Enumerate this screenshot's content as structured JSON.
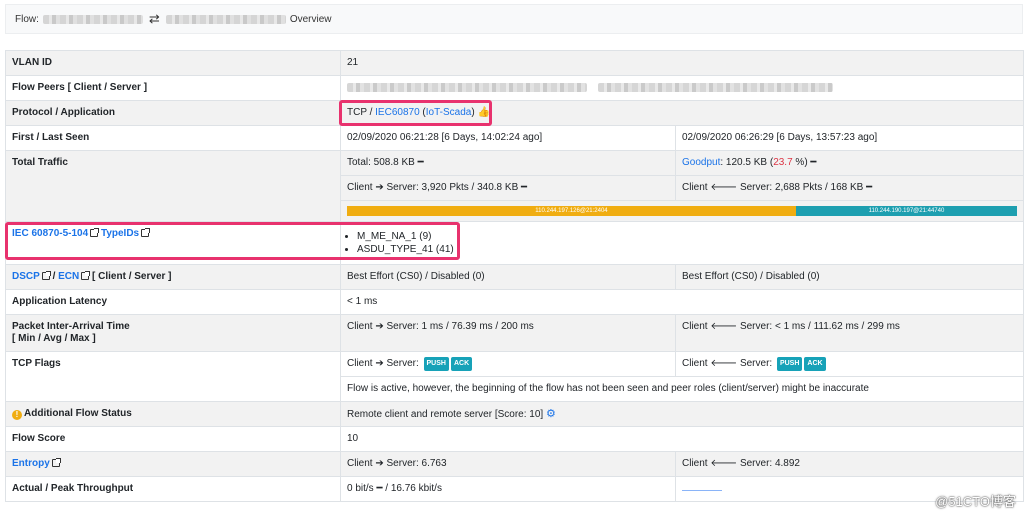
{
  "header": {
    "flow_label": "Flow:",
    "overview": "Overview"
  },
  "rows": {
    "vlan": {
      "label": "VLAN ID",
      "value": "21"
    },
    "peers": {
      "label": "Flow Peers [ Client / Server ]"
    },
    "protocol": {
      "label": "Protocol / Application",
      "proto": "TCP / ",
      "app": "IEC60870",
      "app_sub_open": " (",
      "app_sub": "IoT-Scada",
      "app_sub_close": ")"
    },
    "seen": {
      "label": "First / Last Seen",
      "first": "02/09/2020 06:21:28 [6 Days, 14:02:24 ago]",
      "last": "02/09/2020 06:26:29 [6 Days, 13:57:23 ago]"
    },
    "traffic": {
      "label": "Total Traffic",
      "total": "Total: 508.8 KB ━",
      "goodput_label": "Goodput",
      "goodput_value": ": 120.5 KB (",
      "goodput_pct": "23.7",
      "goodput_tail": " %) ━",
      "c2s": "Client ➔ Server: 3,920 Pkts / 340.8 KB ━",
      "s2c": "Client 🡐 Server: 2,688 Pkts / 168 KB ━",
      "bar_client": "110.244.197.126@21:2404",
      "bar_server": "110.244.190.197@21:44740",
      "bar_client_share": 0.67
    },
    "iec": {
      "label_a": "IEC 60870-5-104",
      "label_b": "TypeIDs",
      "types": [
        "M_ME_NA_1 (9)",
        "ASDU_TYPE_41 (41)"
      ]
    },
    "dscp": {
      "label_a": "DSCP",
      "label_sep": " / ",
      "label_b": "ECN",
      "label_c": " [ Client / Server ]",
      "client": "Best Effort (CS0) / Disabled (0)",
      "server": "Best Effort (CS0) / Disabled (0)"
    },
    "latency": {
      "label": "Application Latency",
      "value": "< 1 ms"
    },
    "iat": {
      "label_a": "Packet Inter-Arrival Time",
      "label_b": "[ Min / Avg / Max ]",
      "c2s": "Client ➔ Server: 1 ms / 76.39 ms / 200 ms",
      "s2c": "Client 🡐 Server: < 1 ms / 111.62 ms / 299 ms"
    },
    "tcp": {
      "label": "TCP Flags",
      "c2s": "Client ➔ Server:",
      "s2c": "Client 🡐 Server:",
      "push": "PUSH",
      "ack": "ACK",
      "note": "Flow is active, however, the beginning of the flow has not been seen and peer roles (client/server) might be inaccurate"
    },
    "status": {
      "label": "Additional Flow Status",
      "value": "Remote client and remote server [Score: 10]"
    },
    "score": {
      "label": "Flow Score",
      "value": "10"
    },
    "entropy": {
      "label": "Entropy",
      "c2s": "Client ➔ Server: 6.763",
      "s2c": "Client 🡐 Server: 4.892"
    },
    "throughput": {
      "label": "Actual / Peak Throughput",
      "value": "0 bit/s ━ / 16.76 kbit/s"
    }
  },
  "watermark": "@51CTO博客",
  "icons": {
    "swap": "swap-arrows-icon",
    "thumb": "thumbs-up-icon",
    "ext": "external-link-icon",
    "warn": "warning-circle-icon",
    "gear": "gear-icon"
  }
}
